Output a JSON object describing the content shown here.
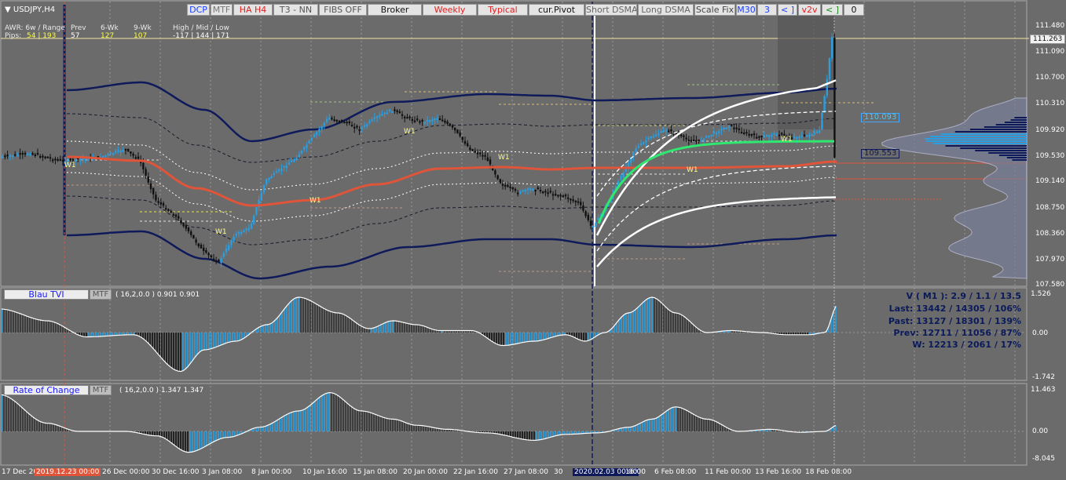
{
  "symbol_title": "USDJPY,H4",
  "toolbar": [
    {
      "label": "DCP",
      "color": "#1a3cff"
    },
    {
      "label": "MTF",
      "color": "#777777"
    },
    {
      "label": "HA H4",
      "color": "#e02020"
    },
    {
      "label": "T3 - NN",
      "color": "#555555"
    },
    {
      "label": "FIBS OFF",
      "color": "#555555"
    },
    {
      "label": "Broker",
      "color": "#111111"
    },
    {
      "label": "Weekly",
      "color": "#e02020"
    },
    {
      "label": "Typical",
      "color": "#e02020"
    },
    {
      "label": "cur.Pivot",
      "color": "#111111"
    },
    {
      "label": "Short DSMA",
      "color": "#666666"
    },
    {
      "label": "Long DSMA",
      "color": "#666666"
    },
    {
      "label": "Scale Fix",
      "color": "#444444"
    },
    {
      "label": "M30",
      "color": "#1a3cff"
    },
    {
      "label": "3",
      "color": "#1a3cff"
    },
    {
      "label": "< ]",
      "color": "#1a3cff"
    },
    {
      "label": "v2v",
      "color": "#e02020"
    },
    {
      "label": "< ]",
      "color": "#1a8a1a"
    },
    {
      "label": "0",
      "color": "#111111"
    }
  ],
  "awr": {
    "row1": [
      "AWR: 6w / Range",
      "Prev",
      "6-Wk",
      "9-Wk",
      "High / Mid / Low"
    ],
    "pips_label": "Pips:",
    "values": [
      {
        "text": "54 | 193",
        "color": "#ffff33"
      },
      {
        "text": "57",
        "color": "#ffffff"
      },
      {
        "text": "127",
        "color": "#ffff33"
      },
      {
        "text": "107",
        "color": "#ffff33"
      },
      {
        "text": "-117  |  144  |  171",
        "color": "#ffffff"
      }
    ]
  },
  "price_axis": [
    "111.480",
    "111.263",
    "111.090",
    "110.700",
    "110.310",
    "109.920",
    "109.530",
    "109.140",
    "108.750",
    "108.360",
    "107.970",
    "107.580"
  ],
  "current_price": "111.263",
  "profile_labels": [
    "110.093",
    "109.553"
  ],
  "week_marker": "W1",
  "indicator1": {
    "name": "Blau TVI",
    "mtf": "MTF",
    "params": "( 16,2,0.0 ) 0.901 0.901",
    "axis": [
      "1.526",
      "0.00",
      "-1.742"
    ],
    "stats": [
      "V ( M1 ): 2.9 / 1.1 / 13.5",
      "Last: 13442 / 14305 / 106%",
      "Past: 13127 / 18301 / 139%",
      "Prev: 12711 / 11056 / 87%",
      "W: 12213 / 2061 / 17%"
    ]
  },
  "indicator2": {
    "name": "Rate of Change",
    "mtf": "MTF",
    "params": "( 16,2,0.0 ) 1.347 1.347",
    "axis": [
      "11.463",
      "0.00",
      "-8.045"
    ]
  },
  "time_axis": [
    "17 Dec 20",
    "2019.12.23 00:00",
    "26 Dec 00:00",
    "30 Dec 16:00",
    "3 Jan 08:00",
    "8 Jan 00:00",
    "10 Jan 16:00",
    "15 Jan 08:00",
    "20 Jan 00:00",
    "22 Jan 16:00",
    "27 Jan 08:00",
    "30",
    "2020.02.03 00:00",
    "16:00",
    "6 Feb 08:00",
    "11 Feb 00:00",
    "13 Feb 16:00",
    "18 Feb 08:00"
  ],
  "colors": {
    "background": "#6b6b6b",
    "bull": "#2a9ee0",
    "bear": "#111111",
    "band": "#0e1a5a",
    "ema": "#e0553a",
    "green_ma": "#2ee870",
    "envelope": "#ffffff"
  }
}
